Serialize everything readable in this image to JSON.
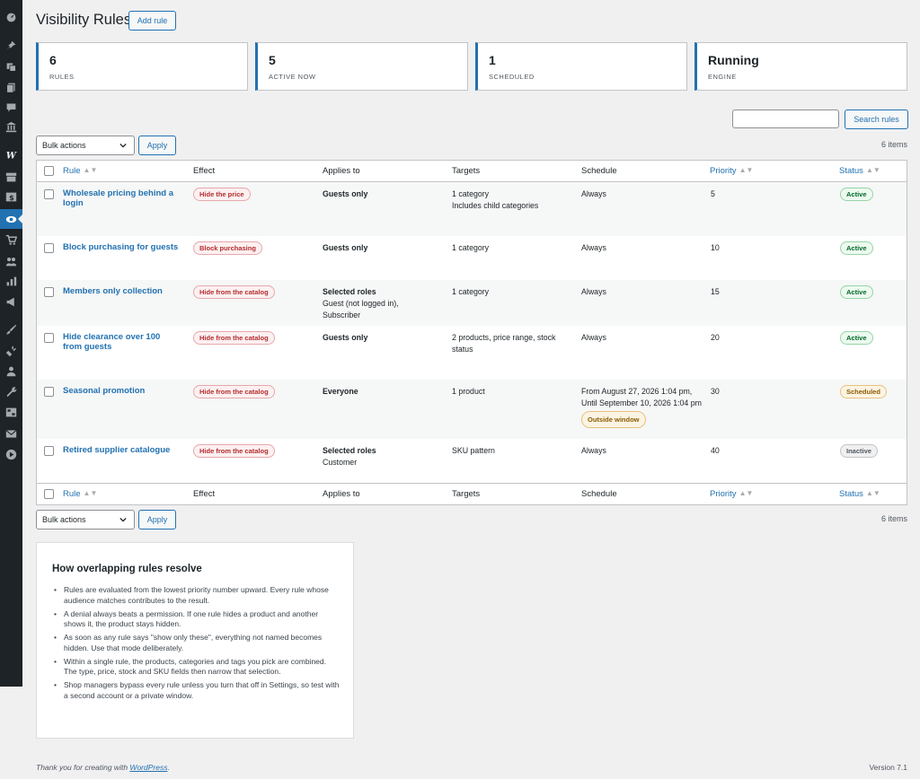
{
  "page": {
    "title": "Visibility Rules",
    "add_rule_label": "Add rule"
  },
  "stats": [
    {
      "value": "6",
      "label": "Rules"
    },
    {
      "value": "5",
      "label": "Active now"
    },
    {
      "value": "1",
      "label": "Scheduled"
    },
    {
      "value": "Running",
      "label": "Engine"
    }
  ],
  "search": {
    "value": "",
    "button_label": "Search rules"
  },
  "bulk": {
    "selected": "Bulk actions",
    "apply_label": "Apply",
    "items_count": "6 items"
  },
  "table": {
    "columns": {
      "rule": "Rule",
      "effect": "Effect",
      "applies": "Applies to",
      "targets": "Targets",
      "schedule": "Schedule",
      "priority": "Priority",
      "status": "Status"
    },
    "rows": [
      {
        "rule": "Wholesale pricing behind a login",
        "effect": "Hide the price",
        "applies": "Guests only",
        "applies_detail": "",
        "targets": "1 category",
        "targets_detail": "Includes child categories",
        "schedule": "Always",
        "schedule_badge": "",
        "priority": "5",
        "status": "Active"
      },
      {
        "rule": "Block purchasing for guests",
        "effect": "Block purchasing",
        "applies": "Guests only",
        "applies_detail": "",
        "targets": "1 category",
        "targets_detail": "",
        "schedule": "Always",
        "schedule_badge": "",
        "priority": "10",
        "status": "Active"
      },
      {
        "rule": "Members only collection",
        "effect": "Hide from the catalog",
        "applies": "Selected roles",
        "applies_detail": "Guest (not logged in), Subscriber",
        "targets": "1 category",
        "targets_detail": "",
        "schedule": "Always",
        "schedule_badge": "",
        "priority": "15",
        "status": "Active"
      },
      {
        "rule": "Hide clearance over 100 from guests",
        "effect": "Hide from the catalog",
        "applies": "Guests only",
        "applies_detail": "",
        "targets": "2 products, price range, stock status",
        "targets_detail": "",
        "schedule": "Always",
        "schedule_badge": "",
        "priority": "20",
        "status": "Active"
      },
      {
        "rule": "Seasonal promotion",
        "effect": "Hide from the catalog",
        "applies": "Everyone",
        "applies_detail": "",
        "targets": "1 product",
        "targets_detail": "",
        "schedule": "From August 27, 2026 1:04 pm, Until September 10, 2026 1:04 pm",
        "schedule_badge": "Outside window",
        "priority": "30",
        "status": "Scheduled"
      },
      {
        "rule": "Retired supplier catalogue",
        "effect": "Hide from the catalog",
        "applies": "Selected roles",
        "applies_detail": "Customer",
        "targets": "SKU pattern",
        "targets_detail": "",
        "schedule": "Always",
        "schedule_badge": "",
        "priority": "40",
        "status": "Inactive"
      }
    ]
  },
  "help": {
    "title": "How overlapping rules resolve",
    "items": [
      "Rules are evaluated from the lowest priority number upward. Every rule whose audience matches contributes to the result.",
      "A denial always beats a permission. If one rule hides a product and another shows it, the product stays hidden.",
      "As soon as any rule says \"show only these\", everything not named becomes hidden. Use that mode deliberately.",
      "Within a single rule, the products, categories and tags you pick are combined. The type, price, stock and SKU fields then narrow that selection.",
      "Shop managers bypass every rule unless you turn that off in Settings, so test with a second account or a private window."
    ]
  },
  "footer": {
    "thanks_prefix": "Thank you for creating with ",
    "thanks_link": "WordPress",
    "thanks_suffix": ".",
    "version": "Version 7.1"
  },
  "sidebar": {
    "icons": [
      "dashboard-icon",
      "pin-icon",
      "media-icon",
      "pages-icon",
      "comments-icon",
      "store-icon",
      "woo-icon",
      "archive-icon",
      "payments-icon",
      "visibility-icon",
      "cart-icon",
      "customers-icon",
      "analytics-icon",
      "marketing-icon",
      "appearance-icon",
      "plugins-icon",
      "users-icon",
      "tools-icon",
      "settings-icon",
      "mail-icon",
      "play-icon"
    ]
  },
  "colors": {
    "accent": "#2271b1",
    "sidebar_bg": "#1d2327",
    "page_bg": "#f0f0f1"
  }
}
